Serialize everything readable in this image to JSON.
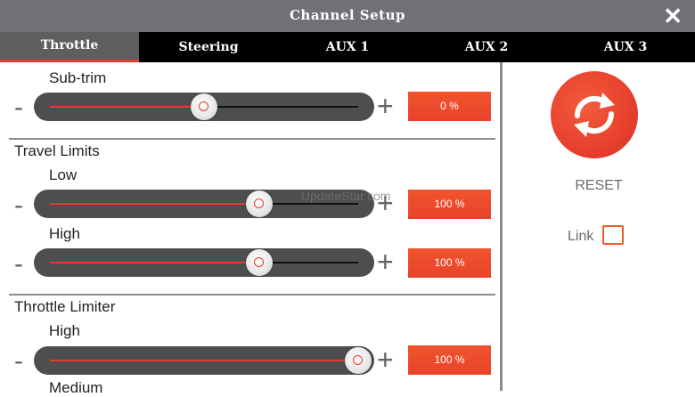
{
  "window": {
    "title": "Channel Setup",
    "close_label": "✕"
  },
  "tabs": [
    {
      "label": "Throttle",
      "active": true
    },
    {
      "label": "Steering",
      "active": false
    },
    {
      "label": "AUX 1",
      "active": false
    },
    {
      "label": "AUX 2",
      "active": false
    },
    {
      "label": "AUX 3",
      "active": false
    }
  ],
  "sections": {
    "subtrim": {
      "label": "Sub-trim",
      "value_text": "0 %",
      "level": 0.5
    },
    "travel_limits": {
      "title": "Travel Limits",
      "low": {
        "label": "Low",
        "value_text": "100 %",
        "level": 0.68
      },
      "high": {
        "label": "High",
        "value_text": "100 %",
        "level": 0.68
      }
    },
    "throttle_limiter": {
      "title": "Throttle Limiter",
      "high": {
        "label": "High",
        "value_text": "100 %",
        "level": 1.0
      },
      "medium": {
        "label": "Medium"
      }
    }
  },
  "controls": {
    "minus": "-",
    "plus": "+"
  },
  "right_panel": {
    "reset_label": "RESET",
    "link_label": "Link",
    "link_checked": false
  },
  "watermark": "UpdateStar.com",
  "colors": {
    "accent": "#e9432b",
    "title_bar": "#707174",
    "tab_bar": "#000000"
  }
}
